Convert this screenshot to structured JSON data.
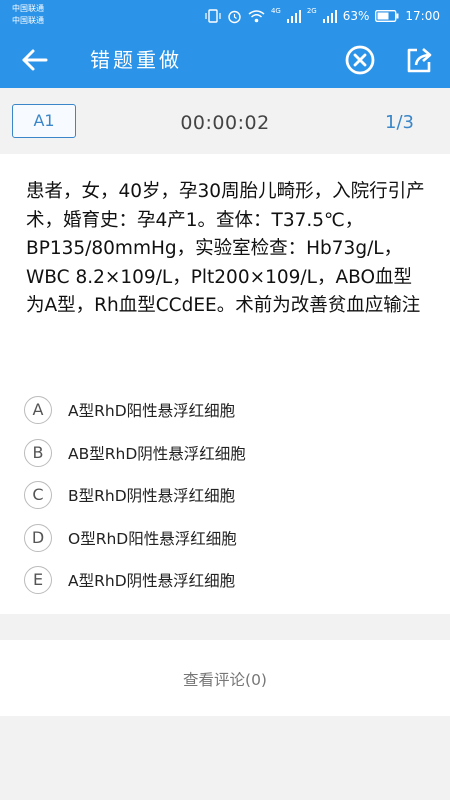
{
  "status_bar": {
    "carrier_1": "中国联通",
    "carrier_2": "中国联通",
    "net_1": "4G",
    "net_2": "2G",
    "battery": "63%",
    "time": "17:00"
  },
  "app_bar": {
    "title": "错题重做",
    "back_icon": "back-arrow-icon",
    "close_icon": "close-circle-icon",
    "share_icon": "share-icon"
  },
  "info_bar": {
    "question_type": "A1",
    "timer": "00:00:02",
    "progress": "1/3"
  },
  "question": {
    "text": "患者，女，40岁，孕30周胎儿畸形，入院行引产术，婚育史：孕4产1。查体：T37.5℃，BP135/80mmHg，实验室检查：Hb73g/L，WBC 8.2×109/L，Plt200×109/L，ABO血型为A型，Rh血型CCdEE。术前为改善贫血应输注",
    "options": [
      {
        "letter": "A",
        "text": "A型RhD阳性悬浮红细胞"
      },
      {
        "letter": "B",
        "text": "AB型RhD阴性悬浮红细胞"
      },
      {
        "letter": "C",
        "text": "B型RhD阴性悬浮红细胞"
      },
      {
        "letter": "D",
        "text": "O型RhD阳性悬浮红细胞"
      },
      {
        "letter": "E",
        "text": "A型RhD阴性悬浮红细胞"
      }
    ]
  },
  "comments": {
    "label": "查看评论(0)"
  },
  "colors": {
    "primary": "#2b93e8",
    "accent_text": "#3a86c8",
    "background": "#f2f2f2"
  }
}
